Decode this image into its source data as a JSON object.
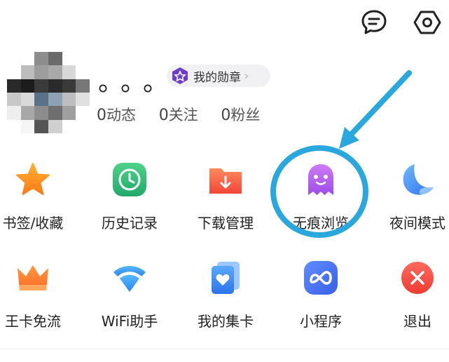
{
  "header": {
    "message_icon": "message-icon",
    "settings_icon": "settings-icon"
  },
  "profile": {
    "username": "。。。",
    "badge_label": "我的勋章",
    "stats": [
      {
        "num": "0",
        "label": "动态"
      },
      {
        "num": "0",
        "label": "关注"
      },
      {
        "num": "0",
        "label": "粉丝"
      }
    ]
  },
  "grid": {
    "row1": [
      "书签/收藏",
      "历史记录",
      "下载管理",
      "无痕浏览",
      "夜间模式"
    ],
    "row2": [
      "王卡免流",
      "WiFi助手",
      "我的集卡",
      "小程序",
      "退出"
    ]
  },
  "colors": {
    "annotation": "#2aa7dc",
    "accent": "#7a4bd6"
  }
}
